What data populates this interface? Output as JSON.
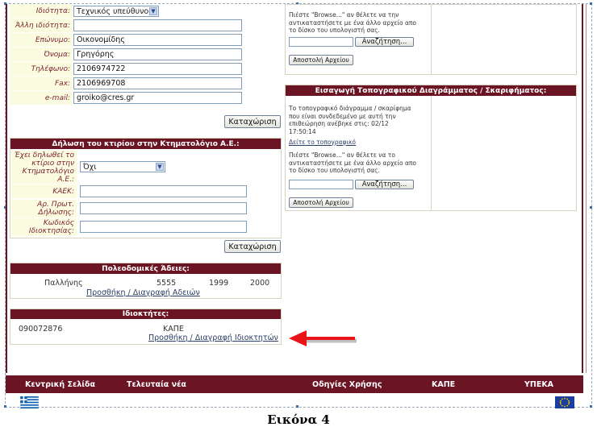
{
  "owner_form": {
    "fields": [
      {
        "label": "Ιδιότητα:",
        "value": "Τεχνικός υπεύθυνος",
        "type": "select"
      },
      {
        "label": "Άλλη ιδιότητα:",
        "value": "",
        "type": "text"
      },
      {
        "label": "Επώνυμο:",
        "value": "Οικονομίδης",
        "type": "text"
      },
      {
        "label": "Όνομα:",
        "value": "Γρηγόρης",
        "type": "text"
      },
      {
        "label": "Τηλέφωνο:",
        "value": "2106974722",
        "type": "text"
      },
      {
        "label": "Fax:",
        "value": "2106969708",
        "type": "text"
      },
      {
        "label": "e-mail:",
        "value": "groiko@cres.gr",
        "type": "text"
      }
    ],
    "submit_label": "Καταχώριση"
  },
  "cadastre": {
    "title": "Δήλωση του κτιρίου στην Κτηματολόγιο Α.Ε.:",
    "fields": [
      {
        "label": "Έχει δηλωθεί το κτίριο στην Κτηματολόγιο Α.Ε.:",
        "value": "Όχι",
        "type": "select"
      },
      {
        "label": "ΚΑΕΚ:",
        "value": "",
        "type": "text"
      },
      {
        "label": "Αρ. Πρωτ. Δήλωσης:",
        "value": "",
        "type": "text"
      },
      {
        "label": "Κωδικός Ιδιοκτησίας:",
        "value": "",
        "type": "text"
      }
    ],
    "submit_label": "Καταχώριση"
  },
  "permits": {
    "title": "Πολεοδομικές Άδειες:",
    "row": {
      "area": "Παλλήνης",
      "number": "5555",
      "year": "1999",
      "year2": "2000"
    },
    "link": "Προσθήκη / Διαγραφή Αδειών"
  },
  "owners": {
    "title": "Ιδιοκτήτες:",
    "row": {
      "id": "090072876",
      "name": "ΚΑΠΕ"
    },
    "link": "Προσθήκη / Διαγραφή Ιδιοκτητών"
  },
  "upload_top": {
    "instructions": [
      "Πιέστε \"Browse...\" αν θέλετε να την",
      "αντικαταστήσετε με ένα άλλο αρχείο απο",
      "το δίσκο του υπολογιστή σας."
    ],
    "browse_label": "Αναζήτηση...",
    "send_label": "Αποστολή Αρχείου"
  },
  "topo": {
    "title": "Εισαγωγή Τοπογραφικού Διαγράμματος / Σκαριφήματος:",
    "info": [
      "Το τοπογραφικό διάγραμμα / σκαρίφημα",
      "που είναι συνδεδεμένο με αυτή την",
      "επιθεώρηση ανέβηκε στις: 02/12",
      "17:50:14"
    ],
    "view_link": "Δείτε το τοπογραφικό",
    "instructions": [
      "Πιέστε \"Browse...\" αν θέλετε να το",
      "αντικαταστήσετε με ένα άλλο αρχείο απο",
      "το δίσκο του υπολογιστή σας."
    ],
    "browse_label": "Αναζήτηση...",
    "send_label": "Αποστολή Αρχείου"
  },
  "nav": {
    "items": [
      "Κεντρική Σελίδα",
      "Τελευταία νέα",
      "Οδηγίες Χρήσης",
      "ΚΑΠΕ",
      "ΥΠΕΚΑ"
    ]
  },
  "caption": "Εικόνα 4",
  "colors": {
    "maroon": "#6b1424",
    "label_bg": "#fbfbe0",
    "label_text": "#7a1f2d",
    "arrow": "#e8141a"
  },
  "icons": [
    "greek-flag-icon",
    "eu-flag-icon",
    "red-arrow-icon"
  ]
}
